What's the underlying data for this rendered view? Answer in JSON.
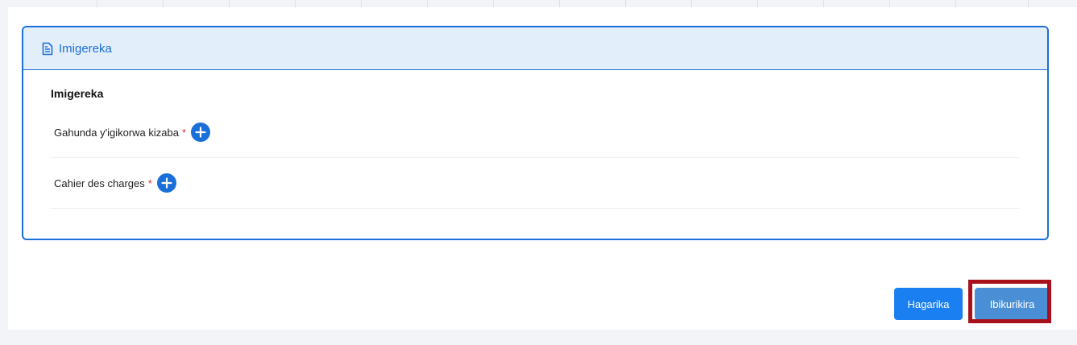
{
  "card": {
    "header_title": "Imigereka",
    "header_icon": "document-icon",
    "section_title": "Imigereka"
  },
  "fields": [
    {
      "label": "Gahunda y'igikorwa kizaba",
      "required_mark": "*"
    },
    {
      "label": "Cahier des charges",
      "required_mark": "*"
    }
  ],
  "actions": {
    "cancel_label": "Hagarika",
    "next_label": "Ibikurikira"
  },
  "colors": {
    "accent": "#1a6fd8",
    "header_bg": "#e3eefb",
    "required": "#e0292b",
    "highlight": "#a8111c"
  }
}
